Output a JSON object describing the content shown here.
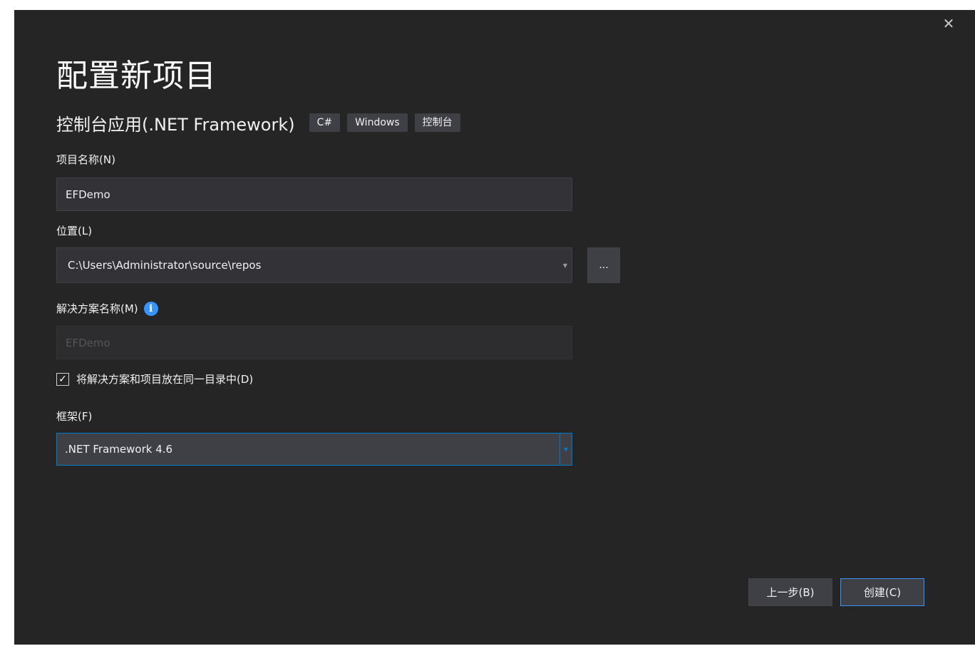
{
  "dialog": {
    "title": "配置新项目",
    "close_icon": "close-icon"
  },
  "template": {
    "name": "控制台应用(.NET Framework)",
    "tags": [
      "C#",
      "Windows",
      "控制台"
    ]
  },
  "project_name": {
    "label": "项目名称(N)",
    "value": "EFDemo"
  },
  "location": {
    "label": "位置(L)",
    "value": "C:\\Users\\Administrator\\source\\repos",
    "browse_label": "..."
  },
  "solution_name": {
    "label": "解决方案名称(M)",
    "value": "EFDemo",
    "info_icon": "info-icon"
  },
  "same_directory": {
    "label": "将解决方案和项目放在同一目录中(D)",
    "checked": true
  },
  "framework": {
    "label": "框架(F)",
    "value": ".NET Framework 4.6"
  },
  "buttons": {
    "back": "上一步(B)",
    "create": "创建(C)"
  },
  "colors": {
    "background": "#252526",
    "accent": "#007acc",
    "info": "#3794ff",
    "field": "#333337"
  }
}
